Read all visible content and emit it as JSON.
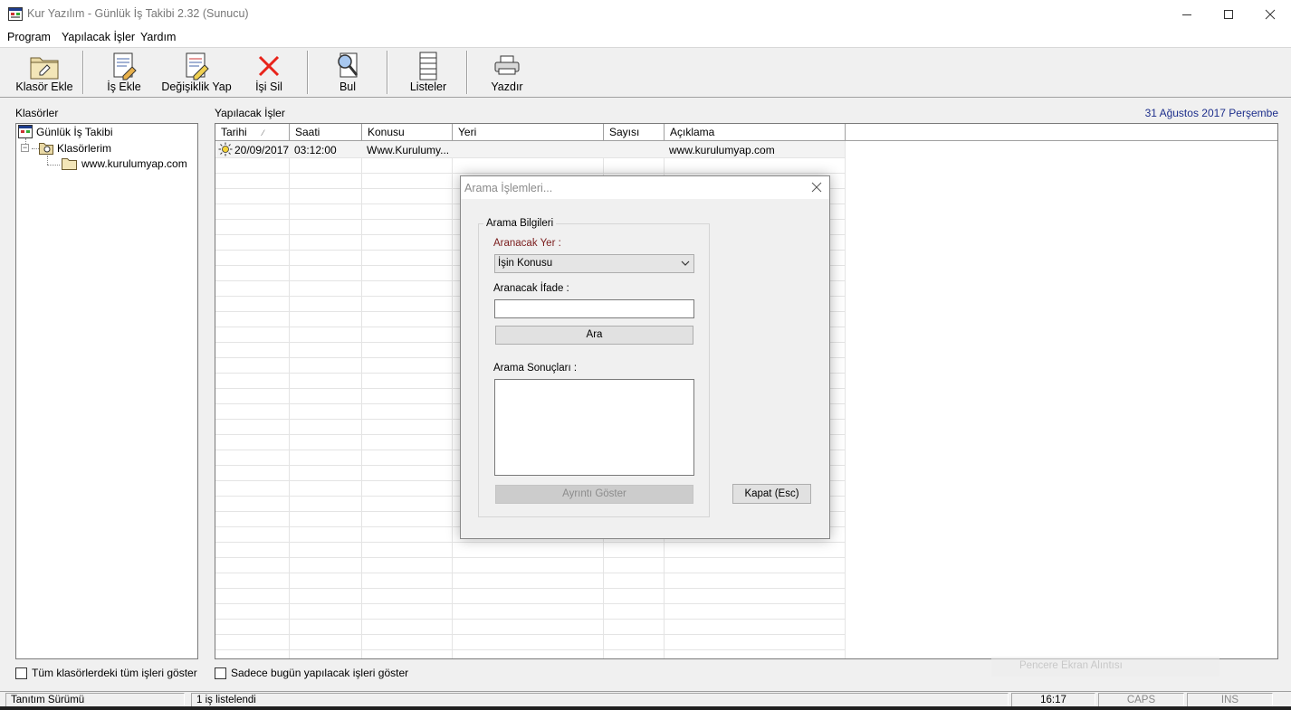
{
  "window": {
    "title": "Kur Yazılım - Günlük İş Takibi 2.32 (Sunucu)",
    "controls": [
      "minimize-icon",
      "maximize-icon",
      "close-icon"
    ]
  },
  "menu": {
    "program": "Program",
    "yapilacak": "Yapılacak İşler",
    "yardim": "Yardım"
  },
  "toolbar": {
    "klasor_ekle": "Klasör Ekle",
    "is_ekle": "İş Ekle",
    "degisiklik": "Değişiklik Yap",
    "isi_sil": "İşi Sil",
    "bul": "Bul",
    "listeler": "Listeler",
    "yazdir": "Yazdır"
  },
  "left": {
    "label": "Klasörler",
    "tree": {
      "root": "Günlük İş Takibi",
      "group": "Klasörlerim",
      "folder": "www.kurulumyap.com"
    }
  },
  "main": {
    "label": "Yapılacak İşler",
    "date": "31 Ağustos 2017 Perşembe",
    "columns": {
      "tarihi": "Tarihi",
      "sort_mark": "⁄",
      "saati": "Saati",
      "konusu": "Konusu",
      "yeri": "Yeri",
      "sayisi": "Sayısı",
      "aciklama": "Açıklama"
    },
    "rows": [
      {
        "tarihi": "20/09/2017",
        "saati": "03:12:00",
        "konusu": "Www.Kurulumy...",
        "yeri": "",
        "sayisi": "",
        "aciklama": "www.kurulumyap.com"
      }
    ]
  },
  "bottom": {
    "chk_tum": "Tüm klasörlerdeki tüm işleri göster",
    "chk_bugun": "Sadece bugün yapılacak işleri göster"
  },
  "status": {
    "surum": "Tanıtım Sürümü",
    "count": "1 iş listelendi",
    "time": "16:17",
    "caps": "CAPS",
    "ins": "INS"
  },
  "notification": {
    "text": "Pencere Ekran Alıntısı"
  },
  "dialog": {
    "title": "Arama İşlemleri...",
    "group_label": "Arama Bilgileri",
    "aranacak_yer_label": "Aranacak Yer :",
    "aranacak_yer_value": "İşin Konusu",
    "ifade_label": "Aranacak İfade :",
    "ifade_value": "",
    "ara_button": "Ara",
    "sonuclar_label": "Arama Sonuçları :",
    "ayrinti_button": "Ayrıntı Göster",
    "kapat_button": "Kapat (Esc)"
  },
  "colors": {
    "date_text": "#1e2f8c",
    "label_red": "#7a1c1c",
    "delete_red": "#e8231a"
  }
}
